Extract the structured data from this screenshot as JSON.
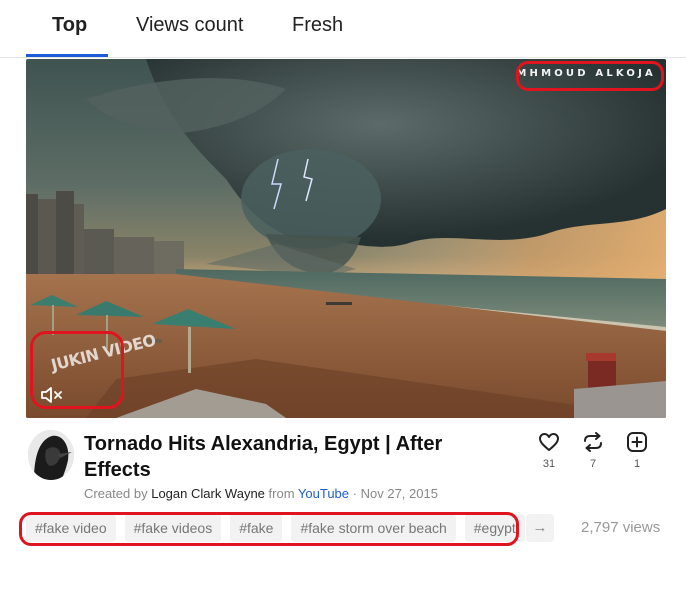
{
  "tabs": [
    {
      "label": "Top",
      "active": true
    },
    {
      "label": "Views count",
      "active": false
    },
    {
      "label": "Fresh",
      "active": false
    }
  ],
  "video": {
    "watermark": "MHMOUD ALKOJA",
    "logo_text": "JUKIN VIDEO",
    "mute_icon": "speaker-muted-icon"
  },
  "post": {
    "title": "Tornado Hits Alexandria, Egypt | After Effects",
    "created_by_label": "Created by",
    "author": "Logan Clark Wayne",
    "from_label": "from",
    "source": "YouTube",
    "separator": "·",
    "date": "Nov 27, 2015"
  },
  "actions": [
    {
      "icon": "heart-icon",
      "count": "31"
    },
    {
      "icon": "repost-icon",
      "count": "7"
    },
    {
      "icon": "add-icon",
      "count": "1"
    }
  ],
  "tags": [
    "#fake video",
    "#fake videos",
    "#fake",
    "#fake storm over beach",
    "#egypt"
  ],
  "more_arrow": "→",
  "views": "2,797 views",
  "colors": {
    "accent": "#1d5cd6",
    "highlight": "#e0141e"
  }
}
